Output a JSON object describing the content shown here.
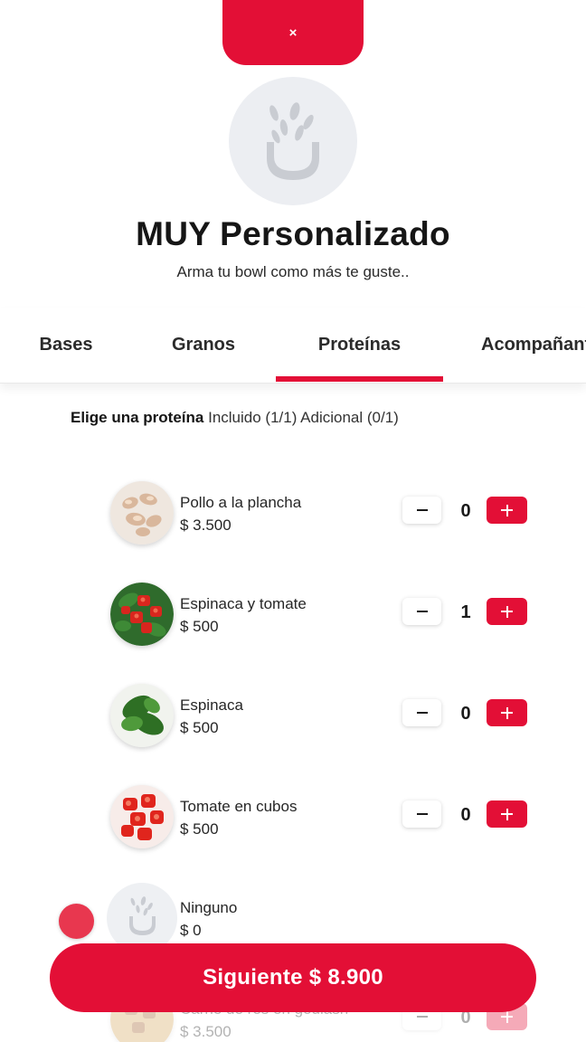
{
  "header": {
    "close_icon": "×",
    "title": "MUY Personalizado",
    "subtitle": "Arma tu bowl como más te guste.."
  },
  "colors": {
    "accent": "#e30f36",
    "logo_bg": "#eceef2",
    "logo_fg": "#c9ccd2"
  },
  "tabs": [
    {
      "label": "Bases",
      "active": false
    },
    {
      "label": "Granos",
      "active": false
    },
    {
      "label": "Proteínas",
      "active": true
    },
    {
      "label": "Acompañantes",
      "active": false
    }
  ],
  "section": {
    "heading": "Elige una proteína",
    "included": "Incluido (1/1)",
    "additional": "Adicional (0/1)"
  },
  "items": [
    {
      "name": "Pollo a la plancha",
      "price": "$ 3.500",
      "qty": "0",
      "thumb": "chicken"
    },
    {
      "name": "Espinaca y tomate",
      "price": "$ 500",
      "qty": "1",
      "thumb": "spinach-tomato"
    },
    {
      "name": "Espinaca",
      "price": "$ 500",
      "qty": "0",
      "thumb": "spinach"
    },
    {
      "name": "Tomate en cubos",
      "price": "$ 500",
      "qty": "0",
      "thumb": "tomato"
    },
    {
      "name": "Ninguno",
      "price": "$ 0",
      "qty": "",
      "thumb": "none"
    },
    {
      "name": "Carne de res en goulash",
      "price": "$ 3.500",
      "qty": "0",
      "thumb": "beef"
    }
  ],
  "footer": {
    "next_label": "Siguiente $ 8.900"
  }
}
